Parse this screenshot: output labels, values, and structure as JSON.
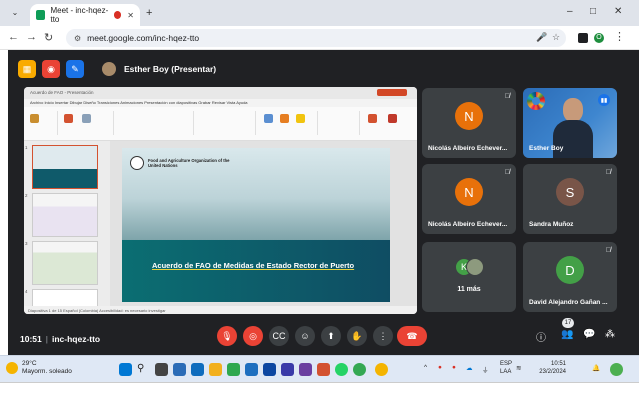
{
  "browser": {
    "tab_title": "Meet - inc-hqez-tto",
    "new_tab": "+",
    "minimize": "–",
    "maximize": "□",
    "close": "✕",
    "url": "meet.google.com/inc-hqez-tto",
    "profile_initial": "O"
  },
  "meet": {
    "presenter_label": "Esther Boy (Presentar)",
    "meeting_time": "10:51",
    "meeting_code": "inc-hqez-tto",
    "participant_count_badge": "17",
    "more_count": "11 más",
    "participants": [
      {
        "name": "Nicolás Albeiro Echever...",
        "initial": "N",
        "color": "#e8710a",
        "muted": true
      },
      {
        "name": "Esther Boy",
        "speaking": true
      },
      {
        "name": "Nicolás Albeiro Echever...",
        "initial": "N",
        "color": "#e8710a",
        "muted": true
      },
      {
        "name": "Sandra Muñoz",
        "initial": "S",
        "color": "#795548",
        "muted": true
      },
      {
        "name": "David Alejandro Gañan ...",
        "initial": "D",
        "color": "#43a047",
        "muted": true
      }
    ],
    "more_initial": "K"
  },
  "presentation": {
    "window_title": "Acuerdo de FAO - Presentación",
    "menu": "Archivo   Inicio   Insertar   Dibujar   Diseño   Transiciones   Animaciones   Presentación con diapositivas   Grabar   Revisar   Vista   Ayuda",
    "org_name": "Food and Agriculture Organization of the United Nations",
    "slide_title": "Acuerdo de FAO de Medidas de Estado Rector de Puerto",
    "status": "Diapositiva 1 de 15     Español (Colombia)     Accesibilidad: es necesario investigar"
  },
  "taskbar": {
    "temperature": "29°C",
    "weather_desc": "Mayorm. soleado",
    "lang_line1": "ESP",
    "lang_line2": "LAA",
    "time": "10:51",
    "date": "23/2/2024"
  },
  "colors": {
    "meet_bg": "#202124",
    "tile_bg": "#3c4043",
    "leave_red": "#ea4335",
    "accent_blue": "#1a73e8"
  }
}
